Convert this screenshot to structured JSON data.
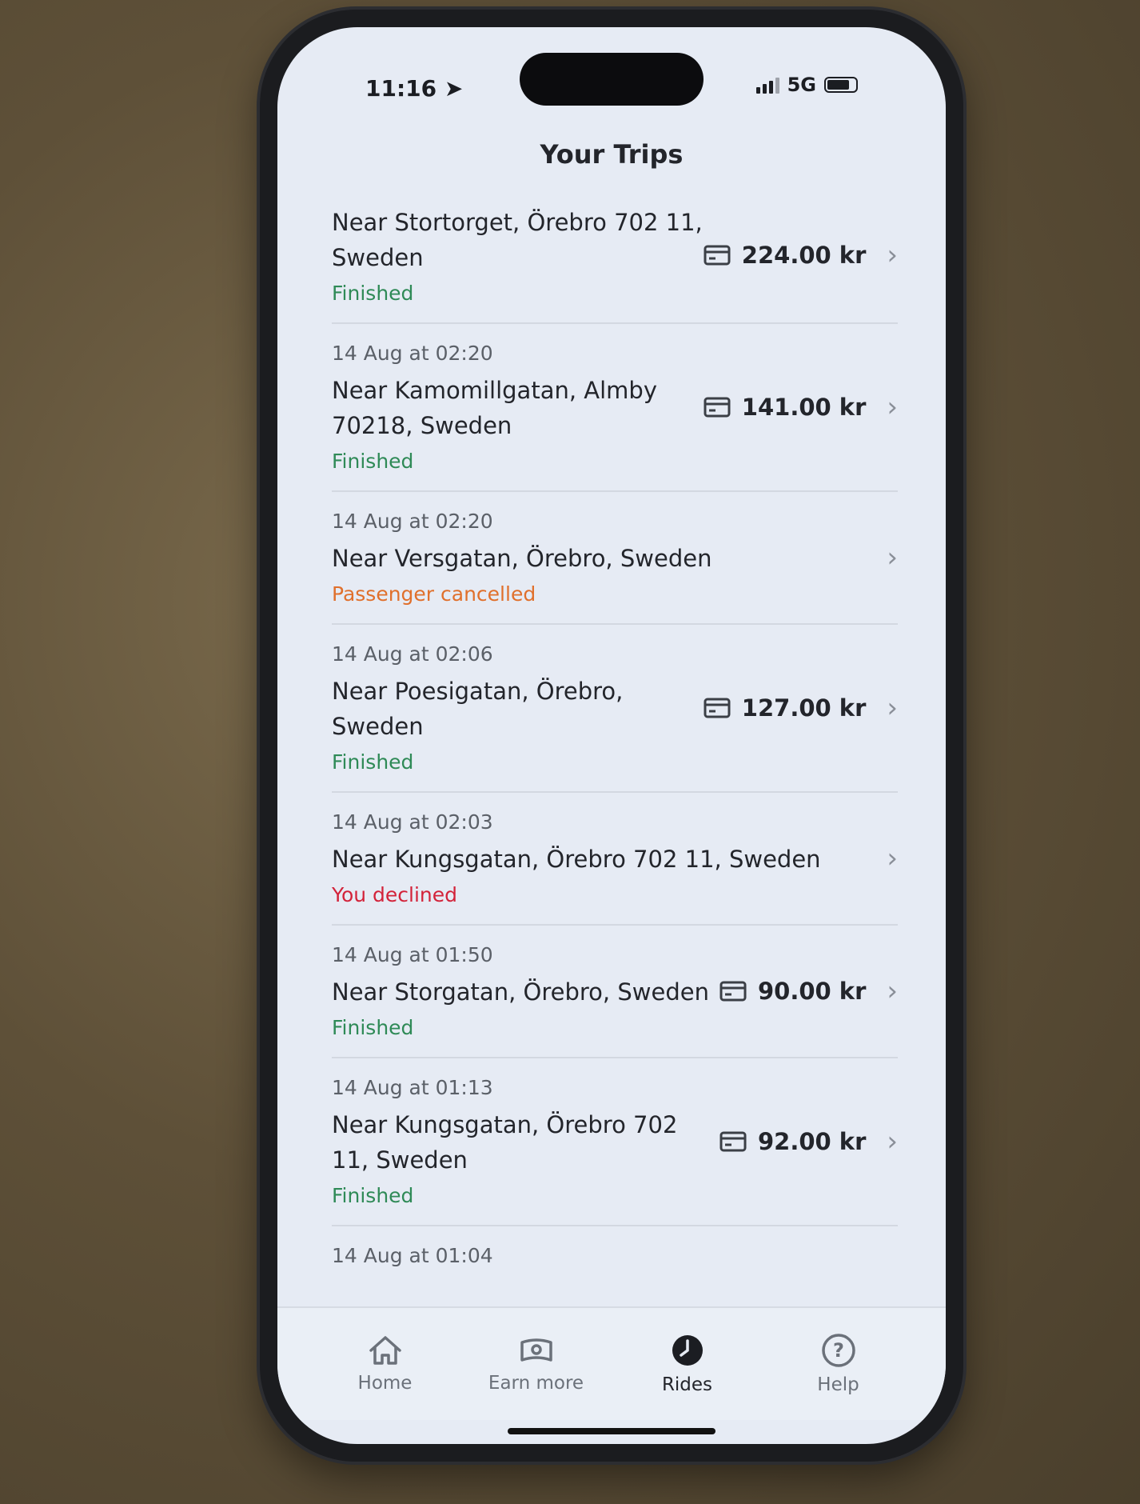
{
  "status_bar": {
    "time": "11:16",
    "network": "5G"
  },
  "header": {
    "title": "Your Trips"
  },
  "colors": {
    "finished": "#2f8a57",
    "cancelled": "#e0702c",
    "declined": "#d3233a"
  },
  "trips": [
    {
      "date": "",
      "address": "Near Stortorget, Örebro 702 11, Sweden",
      "status": "Finished",
      "status_type": "finished",
      "fare": "224.00 kr"
    },
    {
      "date": "14 Aug at 02:20",
      "address": "Near Kamomillgatan, Almby 70218, Sweden",
      "status": "Finished",
      "status_type": "finished",
      "fare": "141.00 kr"
    },
    {
      "date": "14 Aug at 02:20",
      "address": "Near Versgatan, Örebro, Sweden",
      "status": "Passenger cancelled",
      "status_type": "cancelled",
      "fare": ""
    },
    {
      "date": "14 Aug at 02:06",
      "address": "Near Poesigatan, Örebro, Sweden",
      "status": "Finished",
      "status_type": "finished",
      "fare": "127.00 kr"
    },
    {
      "date": "14 Aug at 02:03",
      "address": "Near Kungsgatan, Örebro 702 11, Sweden",
      "status": "You declined",
      "status_type": "declined",
      "fare": ""
    },
    {
      "date": "14 Aug at 01:50",
      "address": "Near Storgatan, Örebro, Sweden",
      "status": "Finished",
      "status_type": "finished",
      "fare": "90.00 kr"
    },
    {
      "date": "14 Aug at 01:13",
      "address": "Near Kungsgatan, Örebro 702 11, Sweden",
      "status": "Finished",
      "status_type": "finished",
      "fare": "92.00 kr"
    },
    {
      "date": "14 Aug at 01:04",
      "address": "",
      "status": "",
      "status_type": "",
      "fare": ""
    }
  ],
  "tabbar": {
    "home": "Home",
    "earn_more": "Earn more",
    "rides": "Rides",
    "help": "Help"
  }
}
